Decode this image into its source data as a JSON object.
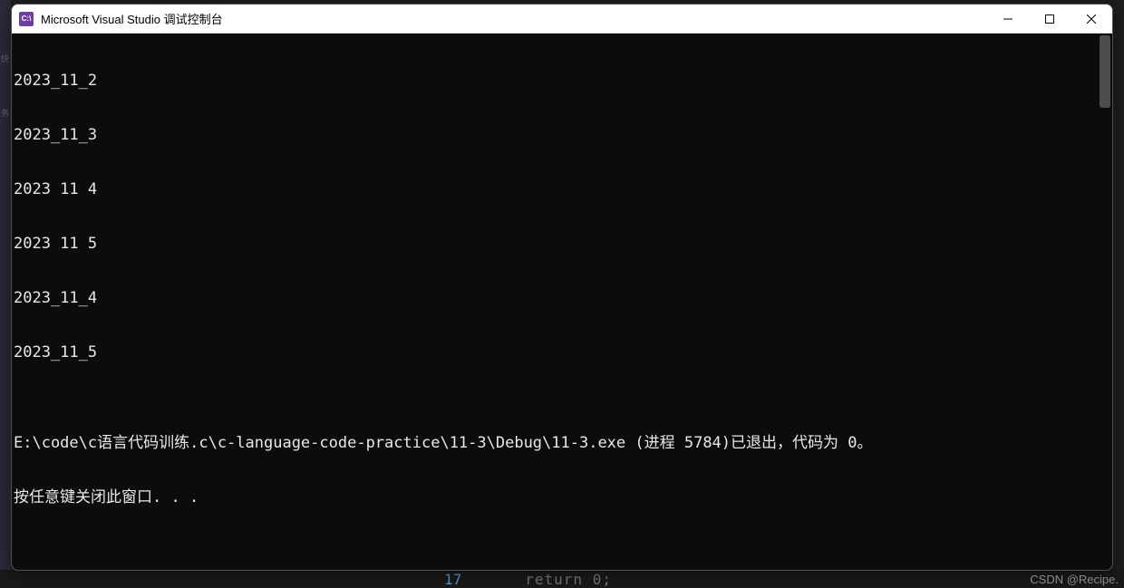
{
  "window": {
    "title": "Microsoft Visual Studio 调试控制台",
    "app_icon_label": "C:\\"
  },
  "console": {
    "lines": [
      "2023_11_2",
      "2023_11_3",
      "2023 11 4",
      "2023 11 5",
      "2023_11_4",
      "2023_11_5",
      "",
      "E:\\code\\c语言代码训练.c\\c-language-code-practice\\11-3\\Debug\\11-3.exe (进程 5784)已退出，代码为 0。",
      "按任意键关闭此窗口. . ."
    ]
  },
  "backdrop": {
    "left_labels": [
      "快",
      "务"
    ],
    "bottom_linenum": "17",
    "bottom_code": "return 0;"
  },
  "watermark": "CSDN @Recipe."
}
